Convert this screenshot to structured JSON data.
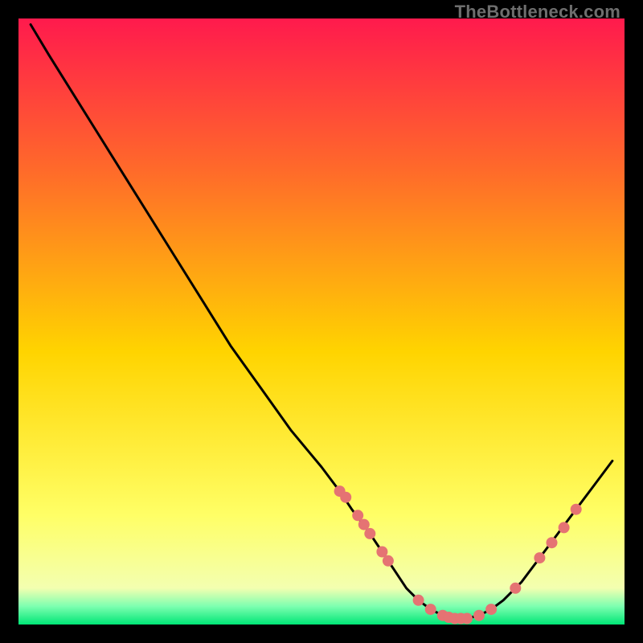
{
  "watermark": "TheBottleneck.com",
  "chart_data": {
    "type": "line",
    "title": "",
    "xlabel": "",
    "ylabel": "",
    "xlim": [
      0,
      100
    ],
    "ylim": [
      0,
      100
    ],
    "grid": false,
    "legend": false,
    "background_gradient": {
      "top_color": "#ff1a4d",
      "mid_color": "#ffe600",
      "bottom_color": "#00e676",
      "bottom_band_start_pct": 95
    },
    "series": [
      {
        "name": "bottleneck-curve",
        "type": "line",
        "color": "#000000",
        "x": [
          2,
          5,
          10,
          15,
          20,
          25,
          30,
          35,
          40,
          45,
          50,
          53,
          55,
          58,
          60,
          62,
          64,
          66,
          68,
          70,
          72,
          74,
          76,
          78,
          80,
          83,
          86,
          89,
          92,
          95,
          98
        ],
        "y": [
          99,
          94,
          86,
          78,
          70,
          62,
          54,
          46,
          39,
          32,
          26,
          22,
          19,
          15,
          12,
          9,
          6,
          4,
          2.5,
          1.5,
          1,
          1,
          1.5,
          2.5,
          4,
          7,
          11,
          15,
          19,
          23,
          27
        ]
      },
      {
        "name": "left-slope-dots",
        "type": "scatter",
        "color": "#e57373",
        "x": [
          53,
          54,
          56,
          57,
          58,
          60,
          61
        ],
        "y": [
          22,
          21,
          18,
          16.5,
          15,
          12,
          10.5
        ]
      },
      {
        "name": "valley-dots",
        "type": "scatter",
        "color": "#e57373",
        "x": [
          66,
          68,
          70,
          71,
          72,
          73,
          74,
          76,
          78
        ],
        "y": [
          4,
          2.5,
          1.5,
          1.2,
          1,
          1,
          1,
          1.5,
          2.5
        ]
      },
      {
        "name": "right-slope-dots",
        "type": "scatter",
        "color": "#e57373",
        "x": [
          82,
          86,
          88,
          90,
          92
        ],
        "y": [
          6,
          11,
          13.5,
          16,
          19
        ]
      }
    ]
  }
}
